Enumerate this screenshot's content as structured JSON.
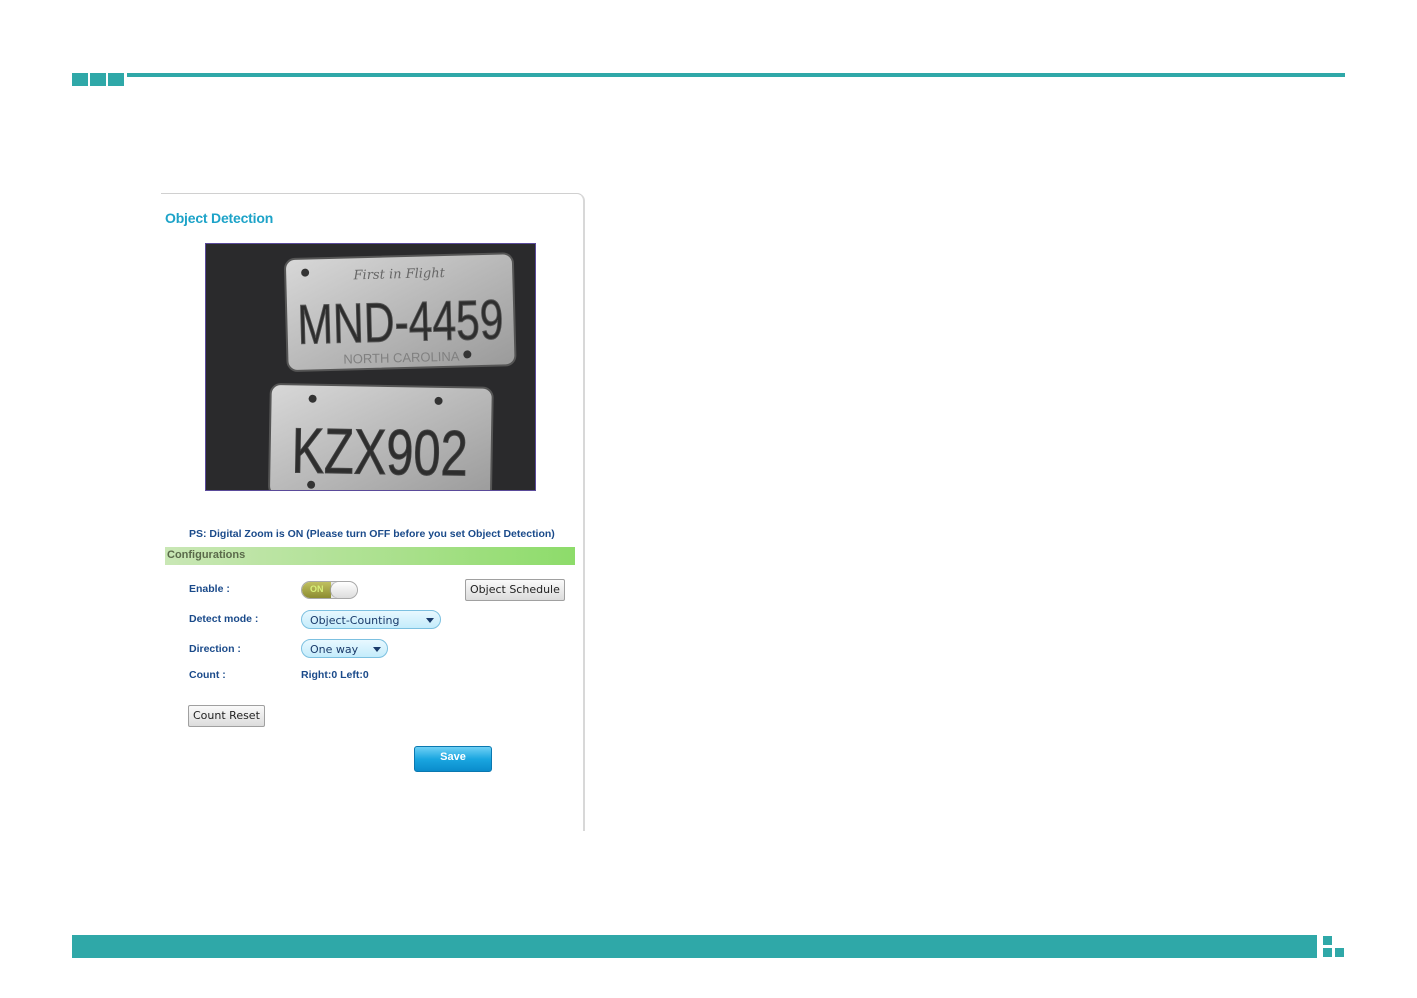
{
  "panel": {
    "title": "Object Detection",
    "note": "PS: Digital Zoom is ON (Please turn OFF before you set Object Detection)",
    "section_label": "Configurations",
    "preview": {
      "plate_top_text": "MND-4459",
      "plate_top_header": "First in Flight",
      "plate_top_footer": "NORTH CAROLINA",
      "plate_bottom_text": "KZX902"
    },
    "fields": {
      "enable_label": "Enable :",
      "enable_state": "ON",
      "detect_mode_label": "Detect mode :",
      "detect_mode_value": "Object-Counting",
      "direction_label": "Direction :",
      "direction_value": "One way",
      "count_label": "Count :",
      "count_value": "Right:0 Left:0"
    },
    "buttons": {
      "object_schedule": "Object Schedule",
      "count_reset": "Count Reset",
      "save": "Save"
    }
  },
  "colors": {
    "accent": "#2fa8a8",
    "title": "#1da3c8",
    "label": "#1a4a8a"
  }
}
